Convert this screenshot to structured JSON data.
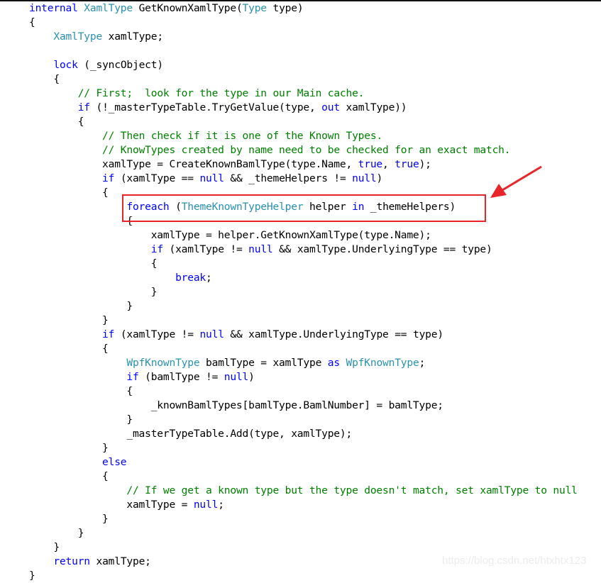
{
  "colors": {
    "keyword": "#0000ff",
    "type": "#2b91af",
    "comment": "#008000",
    "highlight": "#e8252a"
  },
  "code_lines": [
    [
      [
        "k",
        "internal "
      ],
      [
        "t",
        "XamlType"
      ],
      [
        "p",
        " GetKnownXamlType("
      ],
      [
        "t",
        "Type"
      ],
      [
        "p",
        " type)"
      ]
    ],
    [
      [
        "p",
        "{"
      ]
    ],
    [
      [
        "p",
        "    "
      ],
      [
        "t",
        "XamlType"
      ],
      [
        "p",
        " xamlType;"
      ]
    ],
    [
      [
        "p",
        ""
      ]
    ],
    [
      [
        "p",
        "    "
      ],
      [
        "k",
        "lock"
      ],
      [
        "p",
        " (_syncObject)"
      ]
    ],
    [
      [
        "p",
        "    {"
      ]
    ],
    [
      [
        "p",
        "        "
      ],
      [
        "c",
        "// First;  look for the type in our Main cache."
      ]
    ],
    [
      [
        "p",
        "        "
      ],
      [
        "k",
        "if"
      ],
      [
        "p",
        " (!_masterTypeTable.TryGetValue(type, "
      ],
      [
        "k",
        "out"
      ],
      [
        "p",
        " xamlType))"
      ]
    ],
    [
      [
        "p",
        "        {"
      ]
    ],
    [
      [
        "p",
        "            "
      ],
      [
        "c",
        "// Then check if it is one of the Known Types."
      ]
    ],
    [
      [
        "p",
        "            "
      ],
      [
        "c",
        "// KnowTypes created by name need to be checked for an exact match."
      ]
    ],
    [
      [
        "p",
        "            xamlType = CreateKnownBamlType(type.Name, "
      ],
      [
        "k",
        "true"
      ],
      [
        "p",
        ", "
      ],
      [
        "k",
        "true"
      ],
      [
        "p",
        ");"
      ]
    ],
    [
      [
        "p",
        "            "
      ],
      [
        "k",
        "if"
      ],
      [
        "p",
        " (xamlType == "
      ],
      [
        "k",
        "null"
      ],
      [
        "p",
        " && _themeHelpers != "
      ],
      [
        "k",
        "null"
      ],
      [
        "p",
        ")"
      ]
    ],
    [
      [
        "p",
        "            {"
      ]
    ],
    [
      [
        "p",
        "                "
      ],
      [
        "k",
        "foreach"
      ],
      [
        "p",
        " ("
      ],
      [
        "t",
        "ThemeKnownTypeHelper"
      ],
      [
        "p",
        " helper "
      ],
      [
        "k",
        "in"
      ],
      [
        "p",
        " _themeHelpers)"
      ]
    ],
    [
      [
        "p",
        "                {"
      ]
    ],
    [
      [
        "p",
        "                    xamlType = helper.GetKnownXamlType(type.Name);"
      ]
    ],
    [
      [
        "p",
        "                    "
      ],
      [
        "k",
        "if"
      ],
      [
        "p",
        " (xamlType != "
      ],
      [
        "k",
        "null"
      ],
      [
        "p",
        " && xamlType.UnderlyingType == type)"
      ]
    ],
    [
      [
        "p",
        "                    {"
      ]
    ],
    [
      [
        "p",
        "                        "
      ],
      [
        "k",
        "break"
      ],
      [
        "p",
        ";"
      ]
    ],
    [
      [
        "p",
        "                    }"
      ]
    ],
    [
      [
        "p",
        "                }"
      ]
    ],
    [
      [
        "p",
        "            }"
      ]
    ],
    [
      [
        "p",
        "            "
      ],
      [
        "k",
        "if"
      ],
      [
        "p",
        " (xamlType != "
      ],
      [
        "k",
        "null"
      ],
      [
        "p",
        " && xamlType.UnderlyingType == type)"
      ]
    ],
    [
      [
        "p",
        "            {"
      ]
    ],
    [
      [
        "p",
        "                "
      ],
      [
        "t",
        "WpfKnownType"
      ],
      [
        "p",
        " bamlType = xamlType "
      ],
      [
        "k",
        "as"
      ],
      [
        "p",
        " "
      ],
      [
        "t",
        "WpfKnownType"
      ],
      [
        "p",
        ";"
      ]
    ],
    [
      [
        "p",
        "                "
      ],
      [
        "k",
        "if"
      ],
      [
        "p",
        " (bamlType != "
      ],
      [
        "k",
        "null"
      ],
      [
        "p",
        ")"
      ]
    ],
    [
      [
        "p",
        "                {"
      ]
    ],
    [
      [
        "p",
        "                    _knownBamlTypes[bamlType.BamlNumber] = bamlType;"
      ]
    ],
    [
      [
        "p",
        "                }"
      ]
    ],
    [
      [
        "p",
        "                _masterTypeTable.Add(type, xamlType);"
      ]
    ],
    [
      [
        "p",
        "            }"
      ]
    ],
    [
      [
        "p",
        "            "
      ],
      [
        "k",
        "else"
      ]
    ],
    [
      [
        "p",
        "            {"
      ]
    ],
    [
      [
        "p",
        "                "
      ],
      [
        "c",
        "// If we get a known type but the type doesn't match, set xamlType to null"
      ]
    ],
    [
      [
        "p",
        "                xamlType = "
      ],
      [
        "k",
        "null"
      ],
      [
        "p",
        ";"
      ]
    ],
    [
      [
        "p",
        "            }"
      ]
    ],
    [
      [
        "p",
        "        }"
      ]
    ],
    [
      [
        "p",
        "    }"
      ]
    ],
    [
      [
        "p",
        "    "
      ],
      [
        "k",
        "return"
      ],
      [
        "p",
        " xamlType;"
      ]
    ],
    [
      [
        "p",
        "}"
      ]
    ]
  ],
  "watermark": "https://blog.csdn.net/htxhtx123"
}
